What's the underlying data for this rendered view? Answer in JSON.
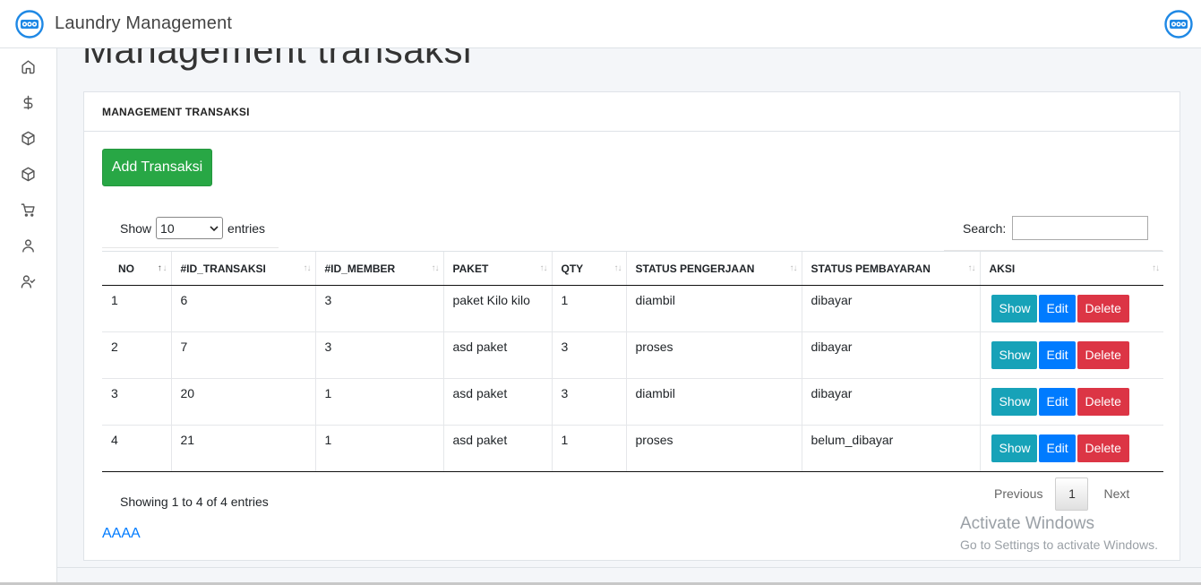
{
  "app": {
    "title": "Laundry Management",
    "logo_icon": "owl-logo-icon",
    "user_icon": "owl-logo-icon"
  },
  "sidebar": {
    "items": [
      {
        "icon": "home-icon"
      },
      {
        "icon": "dollar-icon"
      },
      {
        "icon": "box-icon"
      },
      {
        "icon": "box-icon"
      },
      {
        "icon": "cart-icon"
      },
      {
        "icon": "user-icon"
      },
      {
        "icon": "user-check-icon"
      }
    ]
  },
  "page": {
    "title": "Management transaksi"
  },
  "card": {
    "header": "MANAGEMENT TRANSAKSI",
    "add_button": "Add Transaksi"
  },
  "table_controls": {
    "show_label": "Show",
    "entries_label": "entries",
    "page_length": "10",
    "search_label": "Search:",
    "search_value": ""
  },
  "table": {
    "columns": [
      "NO",
      "#ID_TRANSAKSI",
      "#ID_MEMBER",
      "PAKET",
      "QTY",
      "STATUS PENGERJAAN",
      "STATUS PEMBAYARAN",
      "AKSI"
    ],
    "rows": [
      {
        "no": "1",
        "id_transaksi": "6",
        "id_member": "3",
        "paket": "paket Kilo kilo",
        "qty": "1",
        "status_pengerjaan": "diambil",
        "status_pembayaran": "dibayar"
      },
      {
        "no": "2",
        "id_transaksi": "7",
        "id_member": "3",
        "paket": "asd paket",
        "qty": "3",
        "status_pengerjaan": "proses",
        "status_pembayaran": "dibayar"
      },
      {
        "no": "3",
        "id_transaksi": "20",
        "id_member": "1",
        "paket": "asd paket",
        "qty": "3",
        "status_pengerjaan": "diambil",
        "status_pembayaran": "dibayar"
      },
      {
        "no": "4",
        "id_transaksi": "21",
        "id_member": "1",
        "paket": "asd paket",
        "qty": "1",
        "status_pengerjaan": "proses",
        "status_pembayaran": "belum_dibayar"
      }
    ],
    "actions": {
      "show": "Show",
      "edit": "Edit",
      "delete": "Delete"
    },
    "colors": {
      "show": "#17a2b8",
      "edit": "#007bff",
      "delete": "#dc3545",
      "add": "#28a745"
    }
  },
  "footer": {
    "info": "Showing 1 to 4 of 4 entries",
    "prev": "Previous",
    "page": "1",
    "next": "Next",
    "link": "AAAA"
  },
  "watermark": {
    "title": "Activate Windows",
    "subtitle": "Go to Settings to activate Windows."
  }
}
